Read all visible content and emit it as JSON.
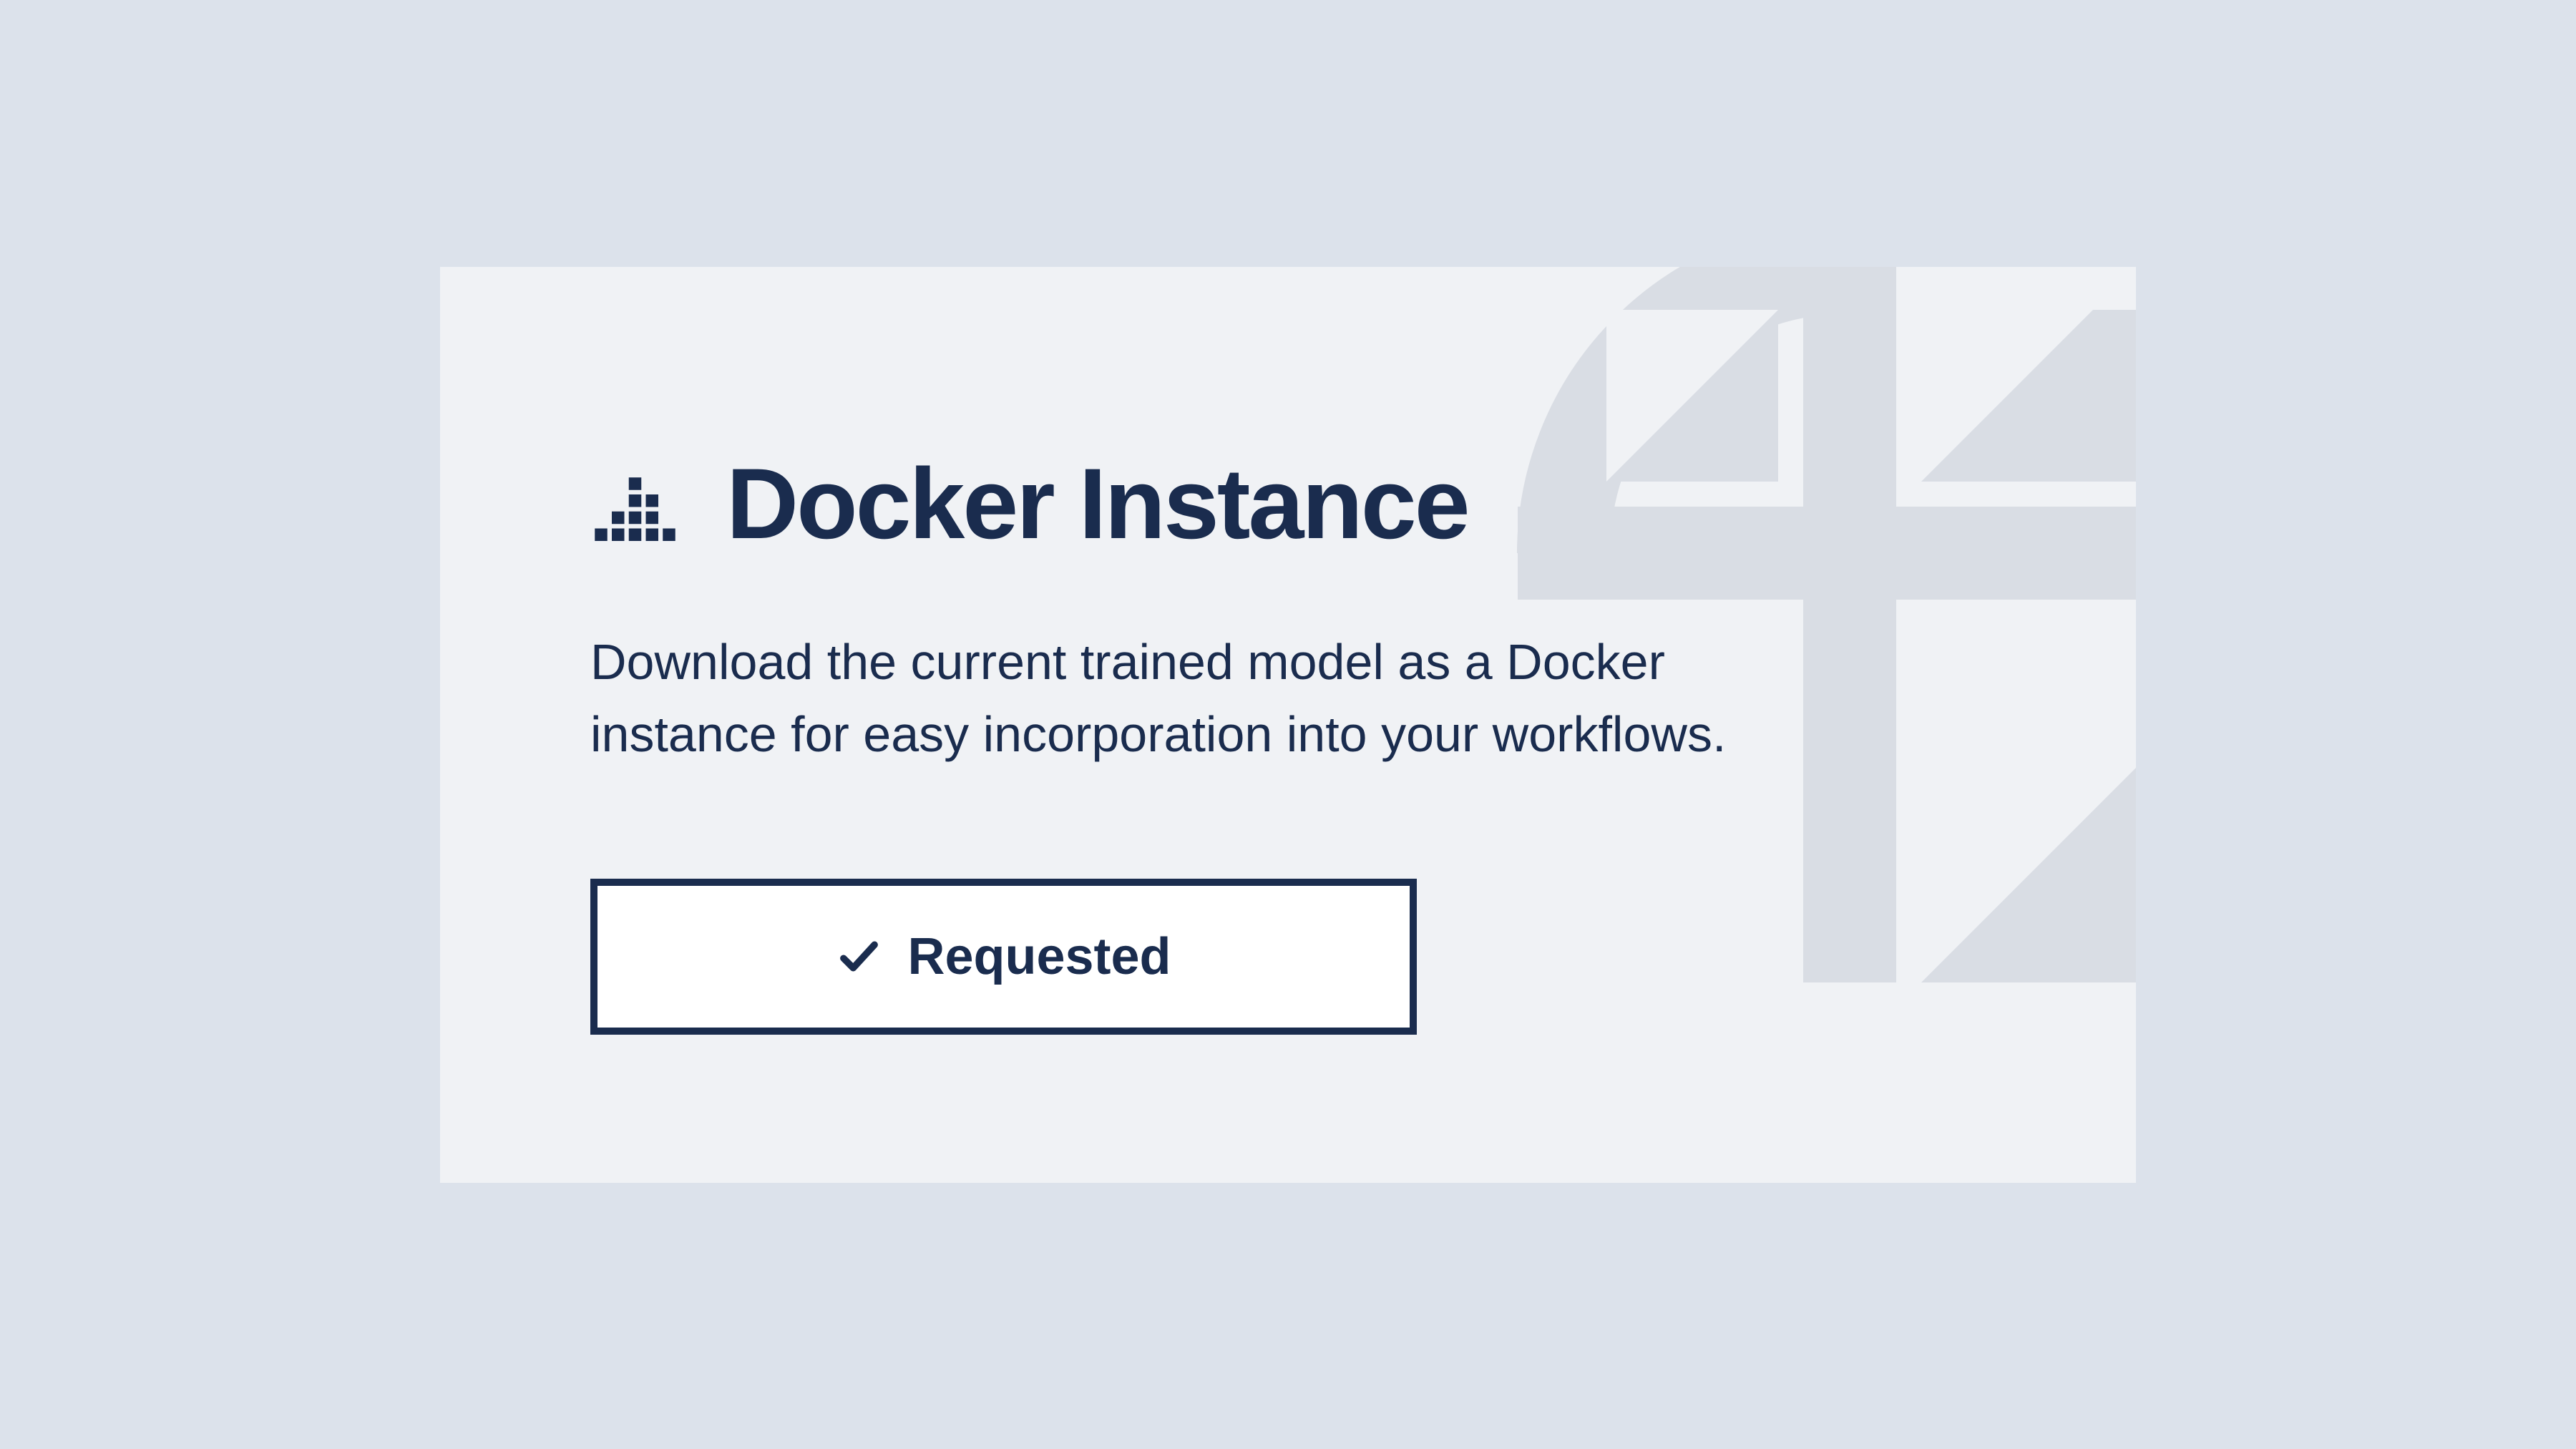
{
  "card": {
    "title": "Docker Instance",
    "description": "Download the current trained model as a Docker instance for easy incorporation into your workflows.",
    "button_label": "Requested"
  },
  "colors": {
    "background": "#dce2eb",
    "card_background": "#f0f2f5",
    "primary": "#1a2c4e",
    "decoration": "#d9dde4"
  }
}
